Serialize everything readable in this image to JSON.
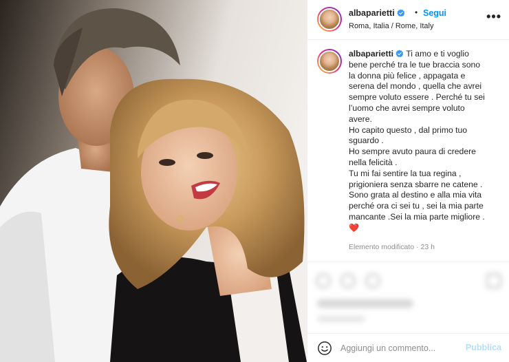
{
  "post": {
    "username": "albaparietti",
    "separator": "•",
    "follow_label": "Segui",
    "location": "Roma, Italia / Rome, Italy",
    "more_icon": "more-horizontal-icon",
    "caption_username": "albaparietti",
    "caption_text": "Ti amo e ti voglio\nbene perché tra le tue braccia sono\nla donna più felice , appagata e\nserena del mondo , quella che avrei\nsempre voluto essere . Perché tu sei\nl’uomo che avrei sempre voluto\navere.\nHo capito questo , dal primo tuo\nsguardo .\nHo sempre avuto paura di credere\nnella felicità .\nTu mi fai sentire la tua regina ,\nprigioniera senza sbarre ne catene .\nSono grata al destino e alla mia vita\nperché ora ci sei tu , sei la mia parte\nmancante .Sei la mia parte migliore .",
    "caption_emoji": "❤️",
    "edited_label": "Elemento modificato",
    "meta_separator": "·",
    "time_ago": "23 h"
  },
  "comment_bar": {
    "placeholder": "Aggiungi un commento...",
    "publish_label": "Pubblica",
    "emoji_icon": "emoji-smile-icon"
  },
  "colors": {
    "accent": "#0095f6",
    "verified": "#3897f0",
    "publish_disabled": "#b2dffc",
    "heart": "#ed1d3c"
  }
}
